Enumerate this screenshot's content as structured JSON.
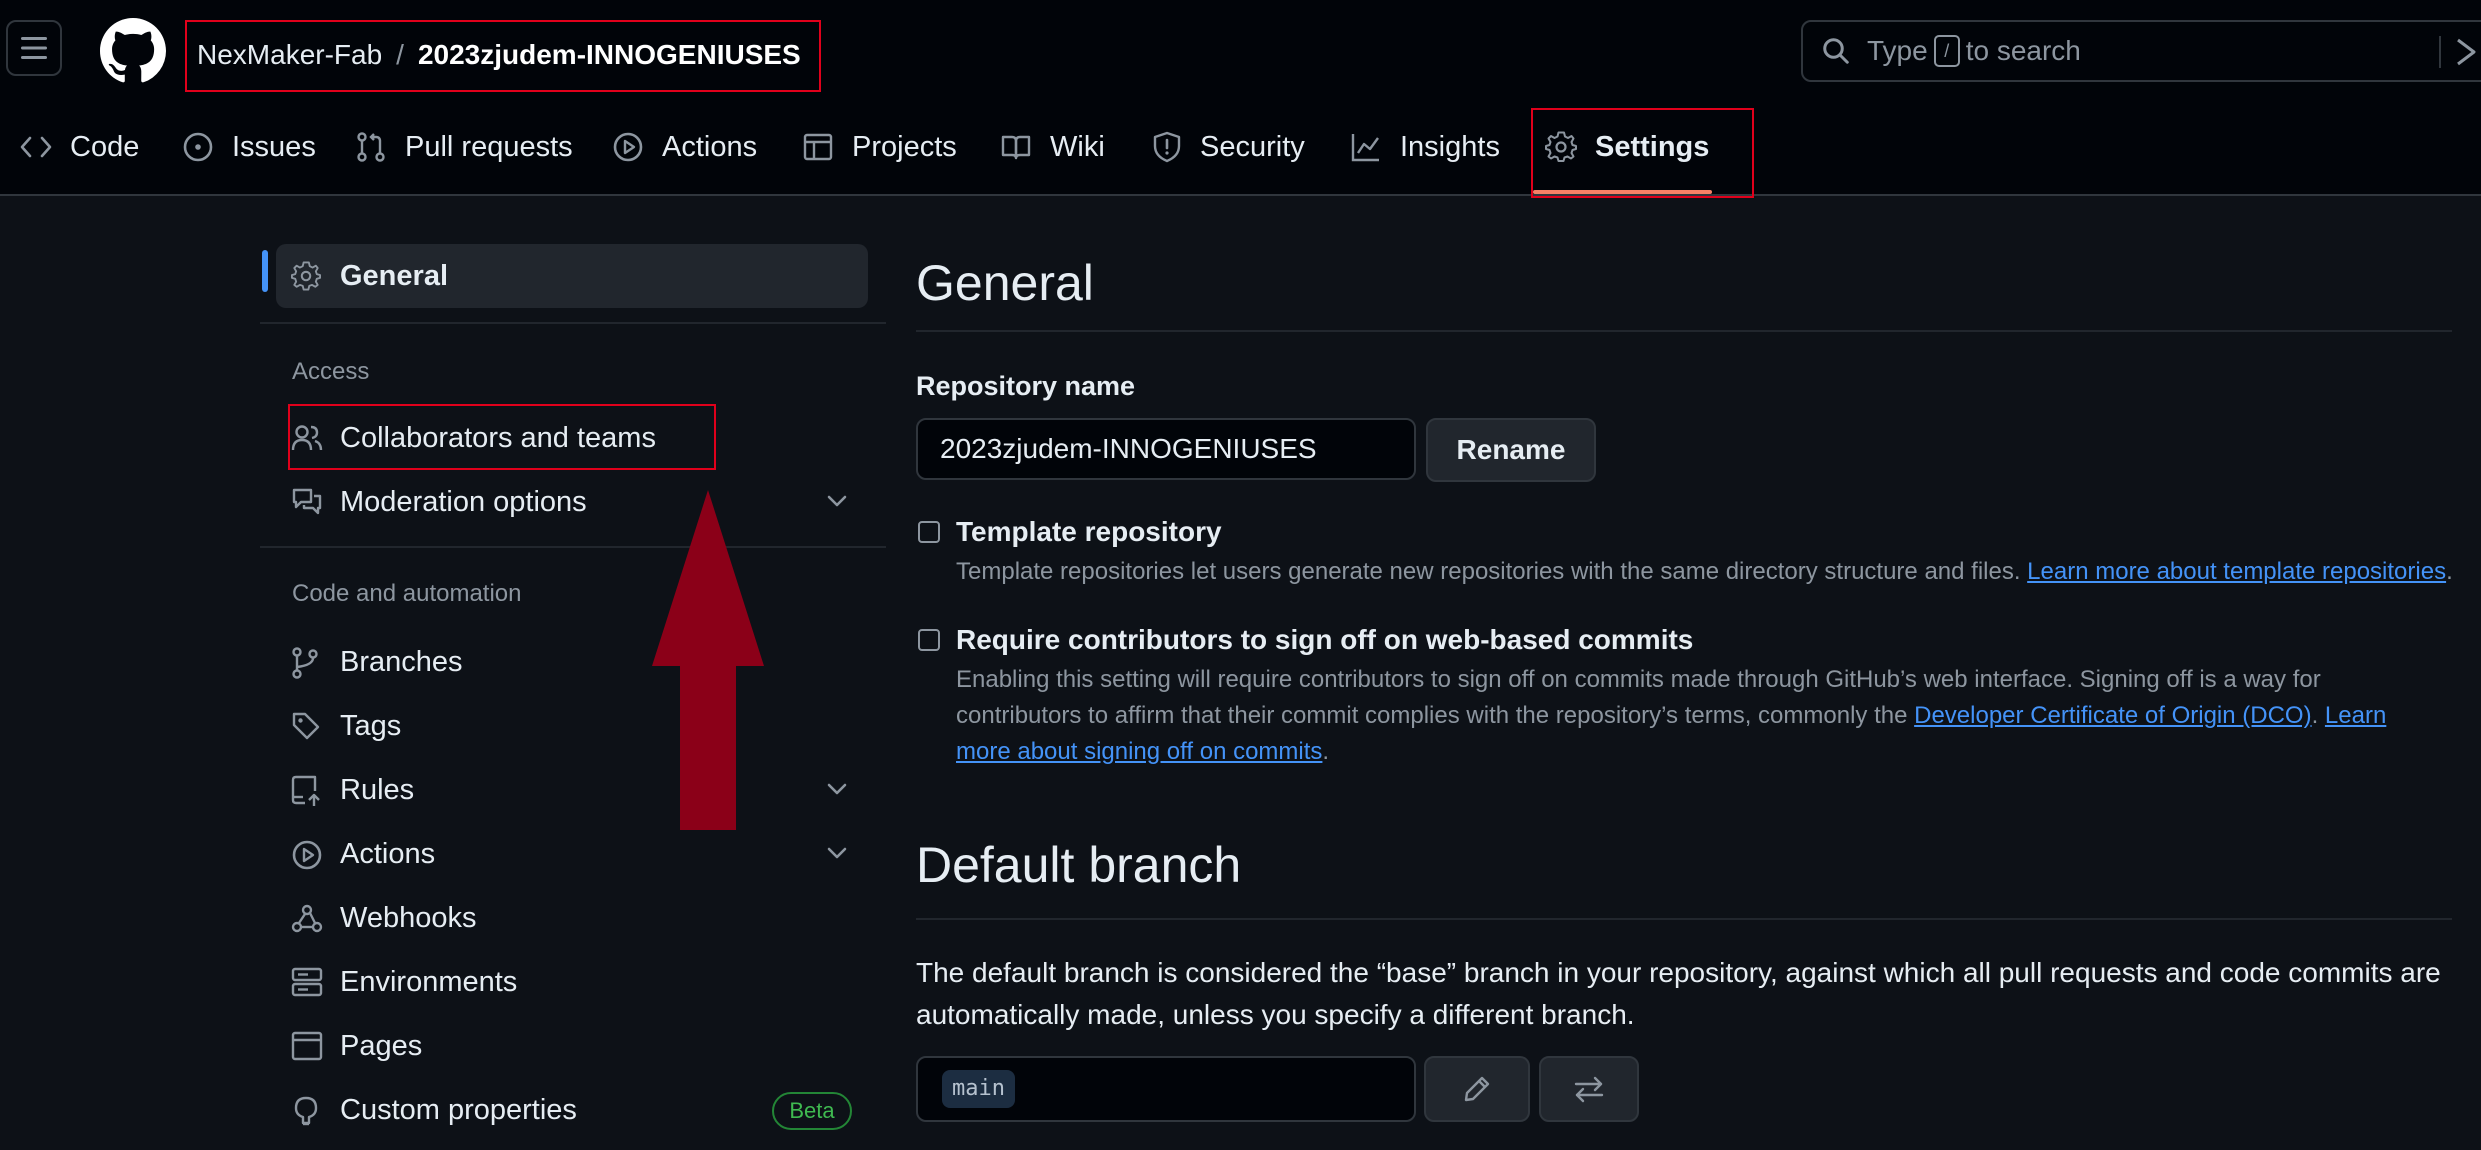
{
  "header": {
    "owner": "NexMaker-Fab",
    "separator": "/",
    "repo": "2023zjudem-INNOGENIUSES",
    "search": {
      "before": "Type",
      "key": "/",
      "after": "to search"
    }
  },
  "tabs": [
    {
      "label": "Code",
      "icon": "code-icon"
    },
    {
      "label": "Issues",
      "icon": "issue-icon"
    },
    {
      "label": "Pull requests",
      "icon": "pull-request-icon"
    },
    {
      "label": "Actions",
      "icon": "play-icon"
    },
    {
      "label": "Projects",
      "icon": "table-icon"
    },
    {
      "label": "Wiki",
      "icon": "book-icon"
    },
    {
      "label": "Security",
      "icon": "shield-icon"
    },
    {
      "label": "Insights",
      "icon": "graph-icon"
    },
    {
      "label": "Settings",
      "icon": "gear-icon",
      "selected": true
    }
  ],
  "sidebar": {
    "general": "General",
    "access_heading": "Access",
    "collaborators": "Collaborators and teams",
    "moderation": "Moderation options",
    "code_heading": "Code and automation",
    "branches": "Branches",
    "tags": "Tags",
    "rules": "Rules",
    "actions": "Actions",
    "webhooks": "Webhooks",
    "environments": "Environments",
    "pages": "Pages",
    "custom_properties": "Custom properties",
    "beta": "Beta"
  },
  "main": {
    "title": "General",
    "repo_name_label": "Repository name",
    "repo_name_value": "2023zjudem-INNOGENIUSES",
    "rename": "Rename",
    "template": {
      "title": "Template repository",
      "desc": "Template repositories let users generate new repositories with the same directory structure and files.",
      "link": "Learn more about template repositories",
      "end": "."
    },
    "signoff": {
      "title": "Require contributors to sign off on web-based commits",
      "desc": "Enabling this setting will require contributors to sign off on commits made through GitHub’s web interface. Signing off is a way for contributors to affirm that their commit complies with the repository’s terms, commonly the",
      "link1": "Developer Certificate of Origin (DCO)",
      "mid": ".",
      "link2": "Learn more about signing off on commits",
      "end": "."
    },
    "default_branch_title": "Default branch",
    "default_branch_desc": "The default branch is considered the “base” branch in your repository, against which all pull requests and code commits are automatically made, unless you specify a different branch.",
    "branch_name": "main"
  },
  "colors": {
    "background": "#0d1117",
    "header": "#010409",
    "accent_link": "#4493f8",
    "tab_underline": "#f78166",
    "annotation": "#e0001b",
    "arrow": "#8b0018",
    "beta": "#3fb950"
  }
}
